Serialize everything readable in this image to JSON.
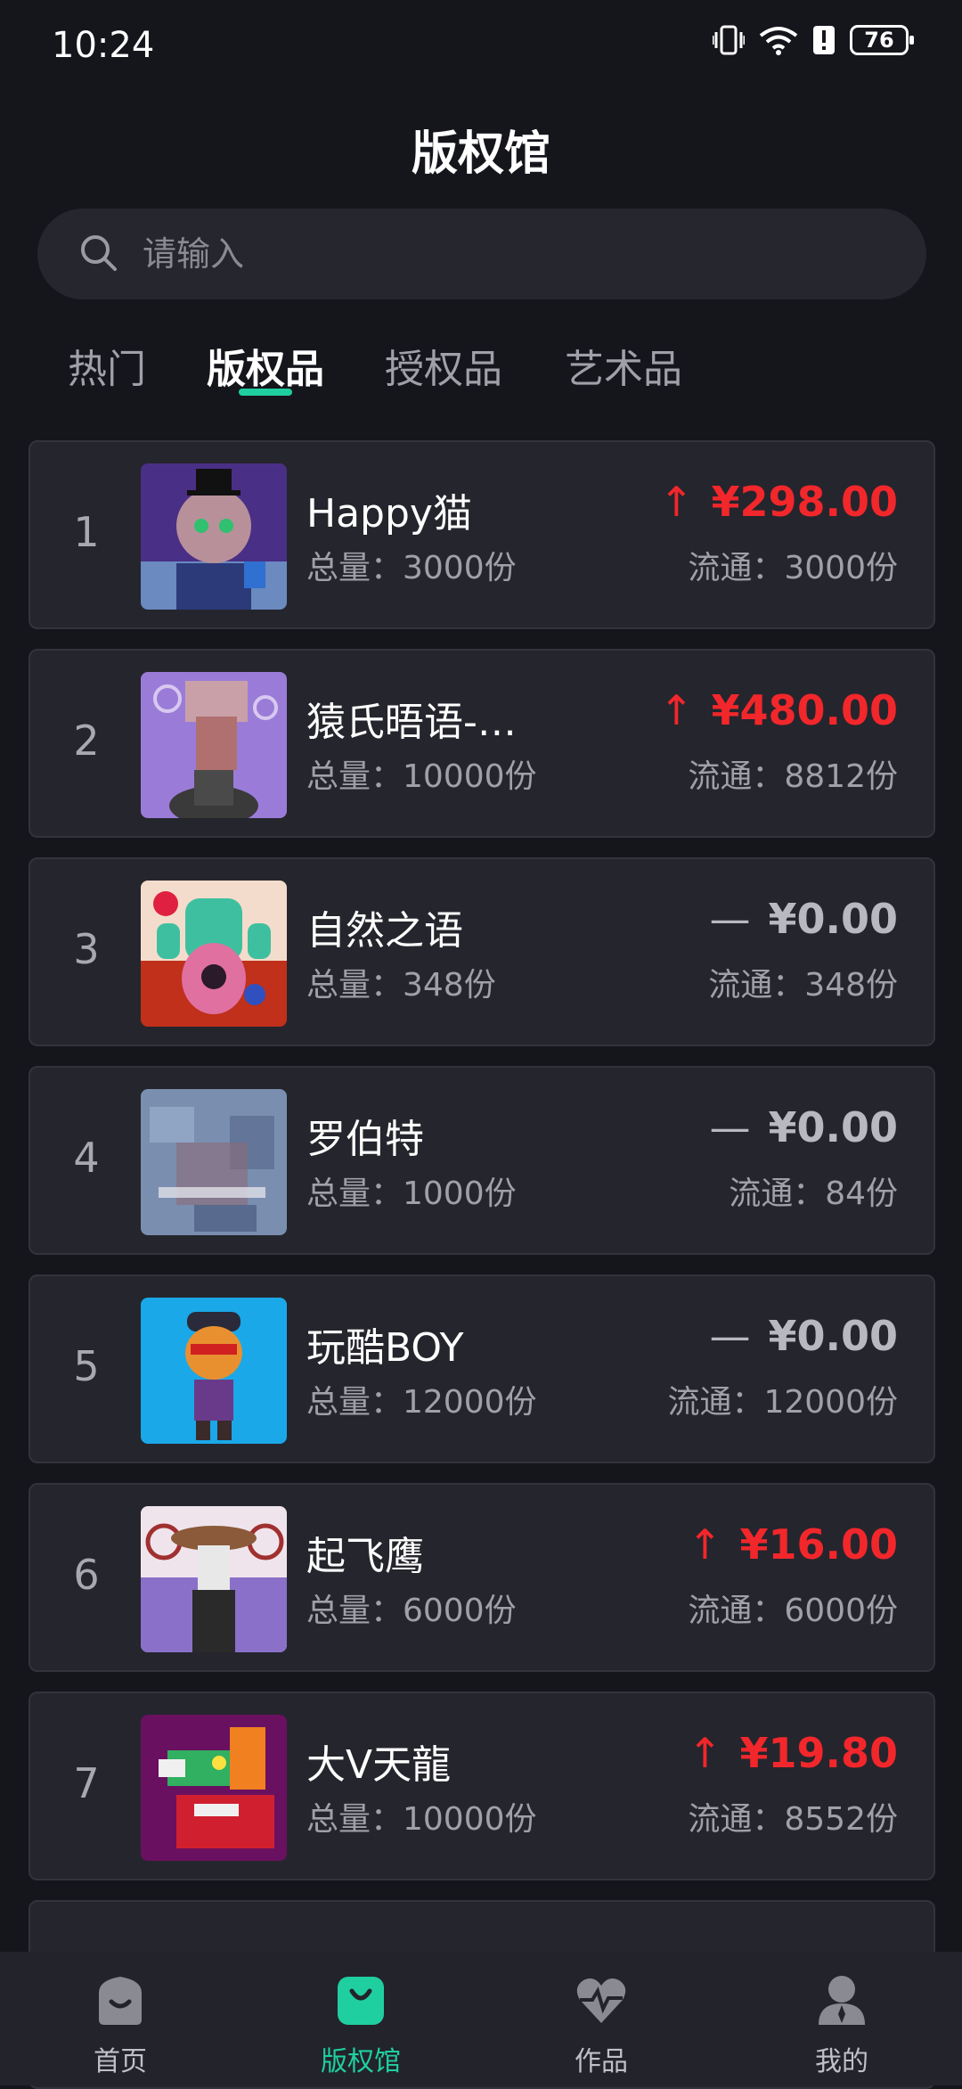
{
  "status": {
    "time": "10:24",
    "battery": "76"
  },
  "header": {
    "title": "版权馆"
  },
  "search": {
    "placeholder": "请输入"
  },
  "tabs": [
    {
      "label": "热门",
      "active": false
    },
    {
      "label": "版权品",
      "active": true
    },
    {
      "label": "授权品",
      "active": false
    },
    {
      "label": "艺术品",
      "active": false
    }
  ],
  "items": [
    {
      "rank": "1",
      "name": "Happy猫",
      "total": "总量：3000份",
      "trend": "↑",
      "price": "¥298.00",
      "circulation": "流通：3000份",
      "direction": "up"
    },
    {
      "rank": "2",
      "name": "猿氏晤语-…",
      "total": "总量：10000份",
      "trend": "↑",
      "price": "¥480.00",
      "circulation": "流通：8812份",
      "direction": "up"
    },
    {
      "rank": "3",
      "name": "自然之语",
      "total": "总量：348份",
      "trend": "—",
      "price": "¥0.00",
      "circulation": "流通：348份",
      "direction": "flat"
    },
    {
      "rank": "4",
      "name": "罗伯特",
      "total": "总量：1000份",
      "trend": "—",
      "price": "¥0.00",
      "circulation": "流通：84份",
      "direction": "flat"
    },
    {
      "rank": "5",
      "name": "玩酷BOY",
      "total": "总量：12000份",
      "trend": "—",
      "price": "¥0.00",
      "circulation": "流通：12000份",
      "direction": "flat"
    },
    {
      "rank": "6",
      "name": "起飞鹰",
      "total": "总量：6000份",
      "trend": "↑",
      "price": "¥16.00",
      "circulation": "流通：6000份",
      "direction": "up"
    },
    {
      "rank": "7",
      "name": "大V天龍",
      "total": "总量：10000份",
      "trend": "↑",
      "price": "¥19.80",
      "circulation": "流通：8552份",
      "direction": "up"
    }
  ],
  "bottom_nav": [
    {
      "label": "首页",
      "icon": "home-icon",
      "active": false
    },
    {
      "label": "版权馆",
      "icon": "bag-icon",
      "active": true
    },
    {
      "label": "作品",
      "icon": "heartbeat-icon",
      "active": false
    },
    {
      "label": "我的",
      "icon": "profile-icon",
      "active": false
    }
  ],
  "colors": {
    "accent": "#1fcfa0",
    "price_up": "#f2272b",
    "price_flat": "#b8b8bf",
    "background": "#15151c",
    "card": "#25252d"
  }
}
